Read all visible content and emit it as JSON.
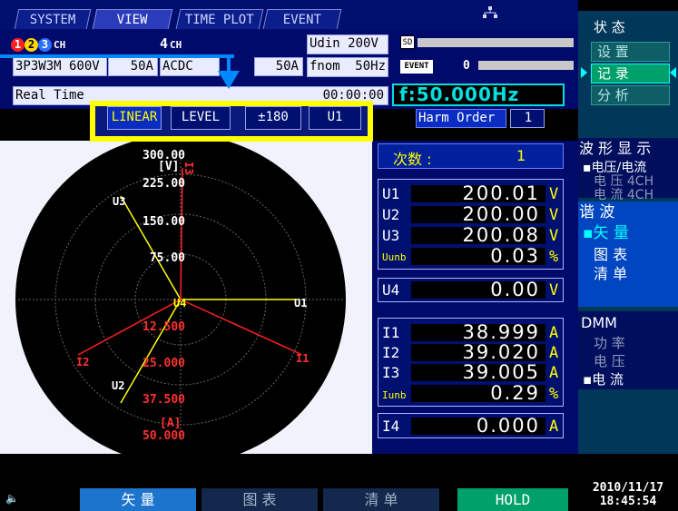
{
  "tabs": [
    {
      "label": "SYSTEM"
    },
    {
      "label": "VIEW"
    },
    {
      "label": "TIME PLOT"
    },
    {
      "label": "EVENT"
    }
  ],
  "network_icon": "network-icon",
  "channels": {
    "group1": "1 2 3",
    "group1_suffix": "CH",
    "group2": "4",
    "group2_suffix": "CH"
  },
  "wiring": {
    "mode": "3P3W3M 600V",
    "range1": "50A",
    "coupling": "ACDC",
    "range2": "50A"
  },
  "udin": {
    "label": "Udin",
    "value": "200V"
  },
  "fnom": {
    "label": "fnom",
    "value": "50Hz"
  },
  "sd_label": "SD",
  "event": {
    "label": "EVENT",
    "count": "0"
  },
  "realtime": {
    "label": "Real Time",
    "time": "00:00:00"
  },
  "freq": {
    "label": "f",
    "value": "50.000Hz"
  },
  "harm_order": {
    "label": "Harm Order",
    "value": "1"
  },
  "toolbar": {
    "linear": "LINEAR",
    "level": "LEVEL",
    "phase": "±180",
    "ref": "U1"
  },
  "order": {
    "label": "次数 :",
    "value": "1"
  },
  "plot": {
    "v_scale": [
      "300.00",
      "[V]",
      "225.00",
      "150.00",
      "75.00"
    ],
    "a_scale": [
      "12.500",
      "25.000",
      "37.500",
      "[A]",
      "50.000"
    ],
    "labels": {
      "u1": "U1",
      "u2": "U2",
      "u3": "U3",
      "u4": "U4",
      "i1": "I1",
      "i2": "I2",
      "i3": "I3"
    }
  },
  "voltage": [
    {
      "label": "U1",
      "value": "200.01",
      "unit": "V"
    },
    {
      "label": "U2",
      "value": "200.00",
      "unit": "V"
    },
    {
      "label": "U3",
      "value": "200.08",
      "unit": "V"
    },
    {
      "label": "Uunb",
      "value": "0.03",
      "unit": "%"
    }
  ],
  "u4": {
    "label": "U4",
    "value": "0.00",
    "unit": "V"
  },
  "current": [
    {
      "label": "I1",
      "value": "38.999",
      "unit": "A"
    },
    {
      "label": "I2",
      "value": "39.020",
      "unit": "A"
    },
    {
      "label": "I3",
      "value": "39.005",
      "unit": "A"
    },
    {
      "label": "Iunb",
      "value": "0.29",
      "unit": "%"
    }
  ],
  "i4": {
    "label": "I4",
    "value": "0.000",
    "unit": "A"
  },
  "menu": {
    "status_title": "状 态",
    "setup": "设 置",
    "record": "记 录",
    "analyze": "分 析",
    "waveform_title": "波 形 显 示",
    "volt_current": "电压/电流",
    "volt4": "电 压 4CH",
    "curr4": "电 流 4CH",
    "harmonic": "谐 波",
    "vector": "矢 量",
    "graph": "图 表",
    "list": "清 单",
    "dmm": "DMM",
    "power": "功 率",
    "voltage": "电 压",
    "current": "电 流"
  },
  "bottom": {
    "vector": "矢 量",
    "graph": "图 表",
    "list": "清 单",
    "hold": "HOLD",
    "date": "2010/11/17",
    "time": "18:45:54"
  },
  "colors": {
    "voltage_vector": "#ffff00",
    "current_vector": "#ff2020",
    "highlight": "#ffff00",
    "accent_cyan": "#00e0e0",
    "hold_green": "#00a06a"
  }
}
